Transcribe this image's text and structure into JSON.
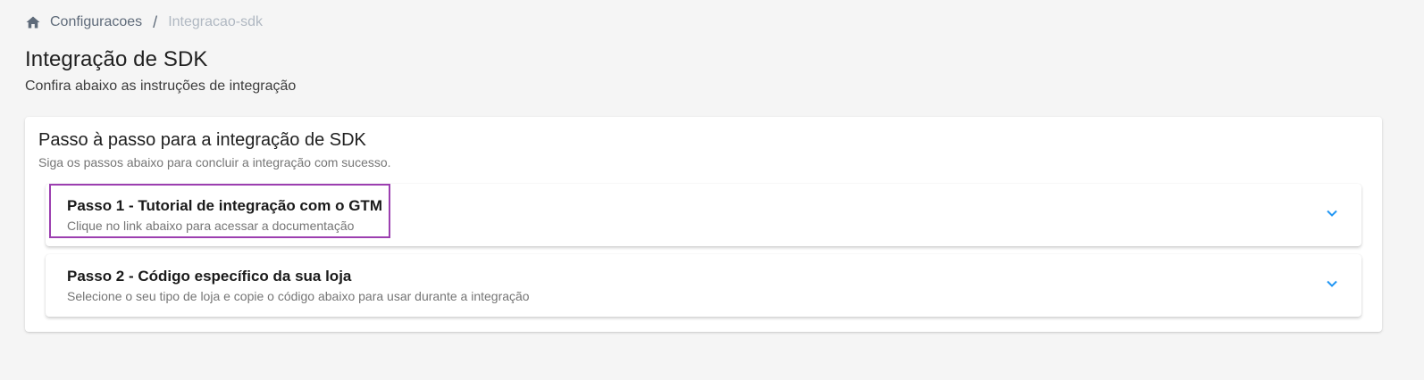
{
  "breadcrumb": {
    "home_icon": "home-icon",
    "items": [
      {
        "label": "Configuracoes"
      },
      {
        "label": "Integracao-sdk"
      }
    ],
    "separator": "/"
  },
  "header": {
    "title": "Integração de SDK",
    "subtitle": "Confira abaixo as instruções de integração"
  },
  "card": {
    "title": "Passo à passo para a integração de SDK",
    "subtitle": "Siga os passos abaixo para concluir a integração com sucesso.",
    "panels": [
      {
        "title": "Passo 1 - Tutorial de integração com o GTM",
        "description": "Clique no link abaixo para acessar a documentação",
        "expand_icon": "chevron-down-icon",
        "highlighted": true
      },
      {
        "title": "Passo 2 - Código específico da sua loja",
        "description": "Selecione o seu tipo de loja e copie o código abaixo para usar durante a integração",
        "expand_icon": "chevron-down-icon",
        "highlighted": false
      }
    ]
  },
  "colors": {
    "background": "#f5f5f5",
    "accent": "#2196f3",
    "highlight": "#9c3fb0",
    "breadcrumb_link": "#5f6b7a",
    "breadcrumb_current": "#b0b8c2"
  }
}
